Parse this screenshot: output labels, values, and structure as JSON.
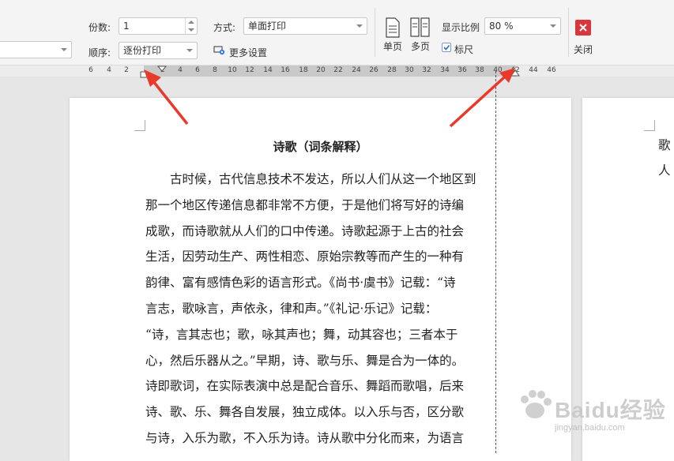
{
  "toolbar": {
    "copies_label": "份数:",
    "copies_value": "1",
    "order_label": "顺序:",
    "order_value": "逐份打印",
    "mode_label": "方式:",
    "mode_value": "单面打印",
    "more_settings": "更多设置",
    "single_page": "单页",
    "multi_page": "多页",
    "zoom_label": "显示比例",
    "zoom_value": "80 %",
    "ruler_checkbox": "标尺",
    "ruler_checked": true,
    "close_label": "关闭"
  },
  "ruler": {
    "ticks": [
      "6",
      "4",
      "2",
      "2",
      "4",
      "6",
      "8",
      "10",
      "12",
      "14",
      "16",
      "18",
      "20",
      "22",
      "24",
      "26",
      "28",
      "30",
      "32",
      "34",
      "36",
      "38",
      "40",
      "42",
      "44",
      "46"
    ]
  },
  "document": {
    "title": "诗歌（词条解释）",
    "lines": [
      "　　古时候，古代信息技术不发达，所以人们从这一个地区到",
      "那一个地区传递信息都非常不方便，于是他们将写好的诗编",
      "成歌，而诗歌就从人们的口中传递。诗歌起源于上古的社会",
      "生活，因劳动生产、两性相恋、原始宗教等而产生的一种有",
      "韵律、富有感情色彩的语言形式。《尚书·虞书》记载：“诗",
      "言志，歌咏言，声依永，律和声。”《礼记·乐记》记载：",
      "“诗，言其志也；歌，咏其声也；舞，动其容也；三者本于",
      "心，然后乐器从之。”早期，诗、歌与乐、舞是合为一体的。",
      "诗即歌词，在实际表演中总是配合音乐、舞蹈而歌唱，后来",
      "诗、歌、乐、舞各自发展，独立成体。以入乐与否，区分歌",
      "与诗，入乐为歌，不入乐为诗。诗从歌中分化而来，为语言"
    ],
    "next_page_lines": [
      "歌",
      "人"
    ]
  },
  "watermark": {
    "brand": "Baidu经验",
    "sub": "jingyan.baidu.com"
  },
  "colors": {
    "arrow": "#e8392b",
    "close": "#d9363e",
    "toolbar_bg": "#f4f4f4",
    "canvas_bg": "#e6e6e6"
  },
  "icons": [
    "single-page-icon",
    "multi-page-icon",
    "settings-icon",
    "close-icon",
    "checkbox-icon"
  ]
}
